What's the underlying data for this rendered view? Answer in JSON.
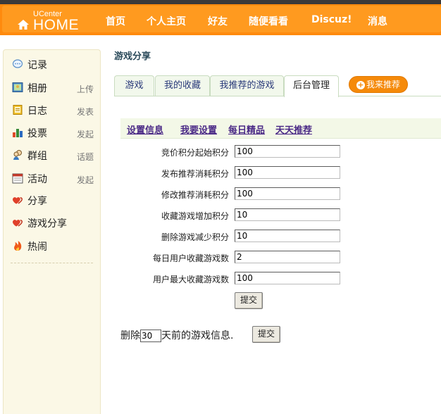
{
  "header": {
    "logo_small": "UCenter",
    "logo_big": "HOME",
    "nav": [
      "首页",
      "个人主页",
      "好友",
      "随便看看",
      "Discuz!",
      "消息"
    ]
  },
  "sidebar": {
    "items": [
      {
        "label": "记录",
        "action": "",
        "icon": "speech-bubble-icon"
      },
      {
        "label": "相册",
        "action": "上传",
        "icon": "photo-icon"
      },
      {
        "label": "日志",
        "action": "发表",
        "icon": "notebook-icon"
      },
      {
        "label": "投票",
        "action": "发起",
        "icon": "bar-chart-icon"
      },
      {
        "label": "群组",
        "action": "话题",
        "icon": "group-icon"
      },
      {
        "label": "活动",
        "action": "发起",
        "icon": "calendar-icon"
      },
      {
        "label": "分享",
        "action": "",
        "icon": "heart-icon"
      },
      {
        "label": "游戏分享",
        "action": "",
        "icon": "heart-icon"
      },
      {
        "label": "热闹",
        "action": "",
        "icon": "fire-icon"
      }
    ]
  },
  "main": {
    "title": "游戏分享",
    "tabs": [
      "游戏",
      "我的收藏",
      "我推荐的游戏",
      "后台管理"
    ],
    "recommend_button": "我来推荐",
    "sublinks": [
      "设置信息",
      "我要设置",
      "每日精品",
      "天天推荐"
    ],
    "form": [
      {
        "label": "竞价积分起始积分",
        "value": "100"
      },
      {
        "label": "发布推荐消耗积分",
        "value": "100"
      },
      {
        "label": "修改推荐消耗积分",
        "value": "100"
      },
      {
        "label": "收藏游戏增加积分",
        "value": "10"
      },
      {
        "label": "删除游戏减少积分",
        "value": "10"
      },
      {
        "label": "每日用户收藏游戏数",
        "value": "2"
      },
      {
        "label": "用户最大收藏游戏数",
        "value": "100"
      }
    ],
    "submit_label": "提交",
    "delete_prefix": "删除",
    "delete_days": "30",
    "delete_suffix": "天前的游戏信息.",
    "delete_submit_label": "提交"
  },
  "colors": {
    "header": "#ff8a0d",
    "sidebar": "#fbf8e6",
    "link": "#4b2a87",
    "recommend": "#f58a0a"
  }
}
